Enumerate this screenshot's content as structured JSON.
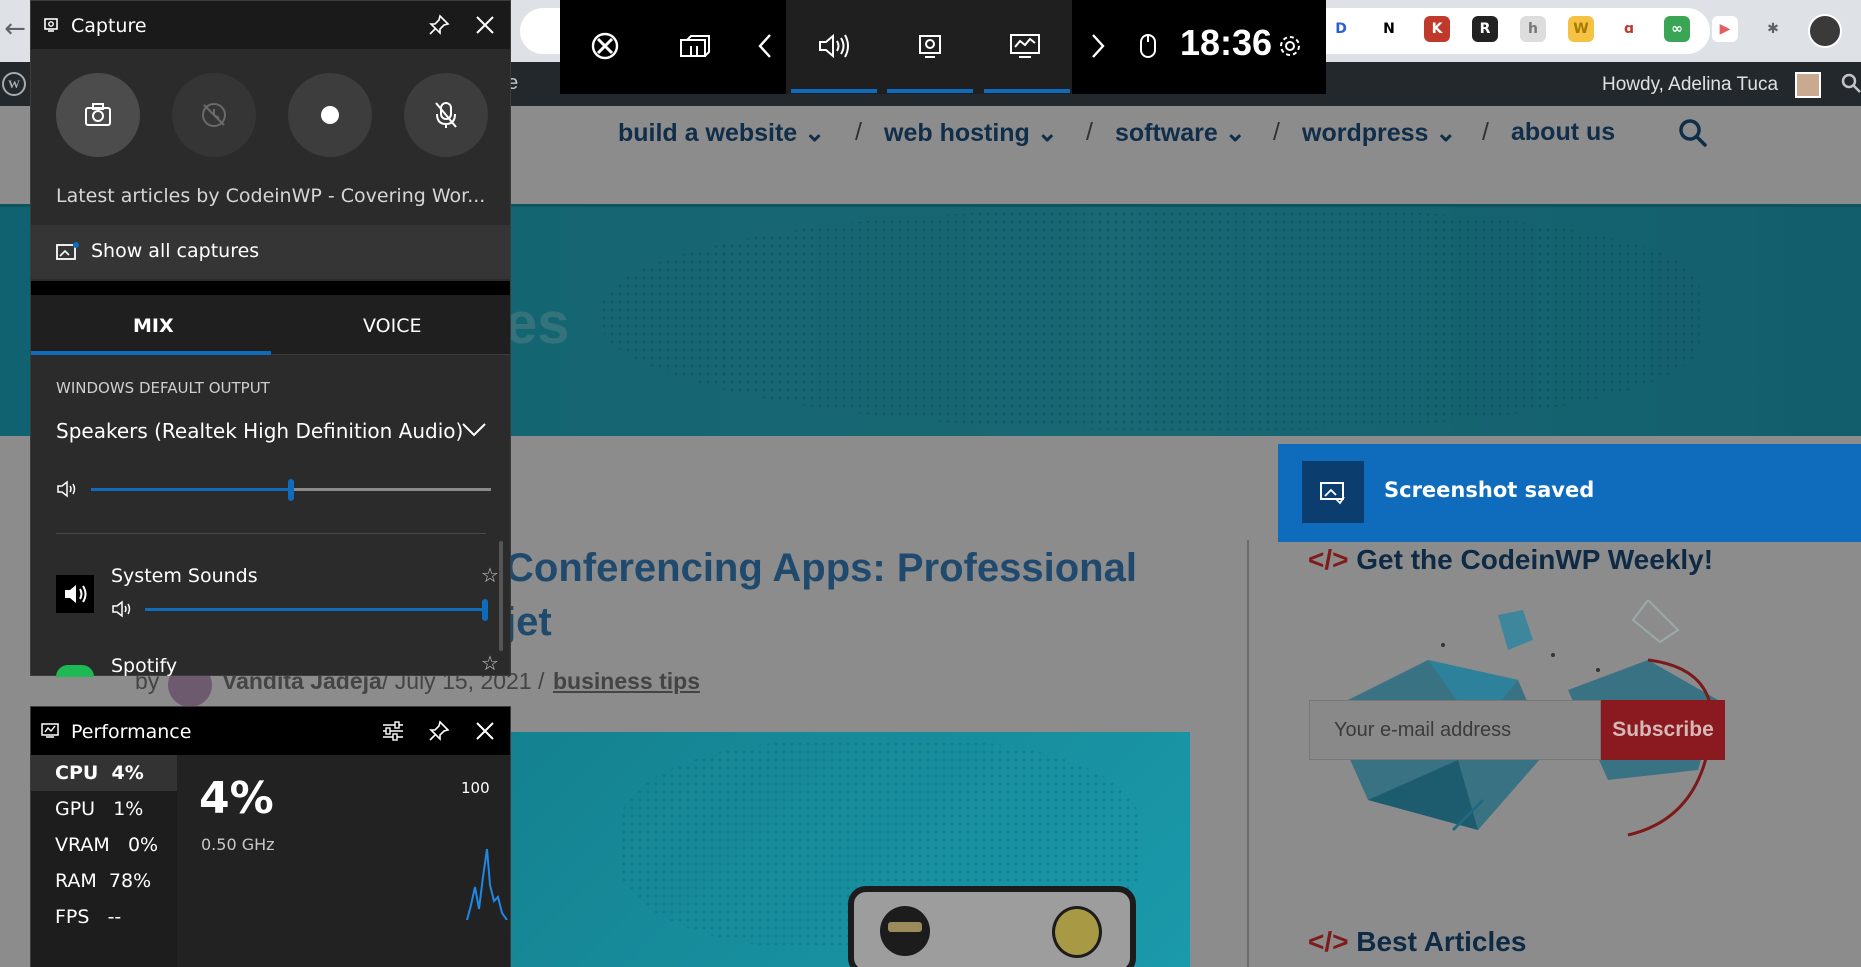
{
  "browser": {
    "back_glyph": "←",
    "wp_fragment": "ge",
    "howdy": "Howdy, Adelina Tuca",
    "extensions": [
      {
        "letter": "D",
        "color": "#2b5fd9",
        "bg": "#ffffff"
      },
      {
        "letter": "N",
        "color": "#000000",
        "bg": "#ffffff"
      },
      {
        "letter": "K",
        "color": "#ffffff",
        "bg": "#c0392b"
      },
      {
        "letter": "R",
        "color": "#ffffff",
        "bg": "#222222"
      },
      {
        "letter": "h",
        "color": "#777777",
        "bg": "#dddddd"
      },
      {
        "letter": "W",
        "color": "#a57b00",
        "bg": "#f6c244"
      },
      {
        "letter": "ɑ",
        "color": "#c0392b",
        "bg": "#ffffff"
      },
      {
        "letter": "∞",
        "color": "#ffffff",
        "bg": "#3aa655"
      },
      {
        "letter": "▶",
        "color": "#e06060",
        "bg": "#ffffff"
      },
      {
        "letter": "✱",
        "color": "#5f6368",
        "bg": "#dee1e6"
      }
    ]
  },
  "site": {
    "nav": [
      {
        "label": "build a website"
      },
      {
        "label": "web hosting"
      },
      {
        "label": "software"
      },
      {
        "label": "wordpress"
      },
      {
        "label": "about us"
      }
    ],
    "nav_separator": "/",
    "hero_fragment": "es",
    "article_title_line1": "Conferencing Apps: Professional",
    "article_title_line2": "jet",
    "byline_prefix": "by",
    "author": "Vandita Jadeja",
    "date": "/ July 15, 2021 /",
    "category": "business tips",
    "sidebar": {
      "code_tag": "</>",
      "weekly_title": "Get the CodeinWP Weekly!",
      "email_placeholder": "Your e-mail address",
      "subscribe_label": "Subscribe",
      "best_title": "Best Articles"
    }
  },
  "xbox_bar": {
    "clock": "18:36",
    "icons": [
      "xbox-icon",
      "widget-menu-icon",
      "chevron-left-icon",
      "audio-icon",
      "capture-icon",
      "performance-icon",
      "chevron-right-icon",
      "mouse-icon",
      "settings-icon"
    ],
    "accent": "#0f6cbd"
  },
  "capture": {
    "title": "Capture",
    "description": "Latest articles by CodeinWP - Covering Wor...",
    "show_all": "Show all captures"
  },
  "audio": {
    "tabs": [
      {
        "label": "MIX"
      },
      {
        "label": "VOICE"
      }
    ],
    "output_label": "WINDOWS DEFAULT OUTPUT",
    "output_device": "Speakers (Realtek High Definition Audio)",
    "master_volume": 0.5,
    "apps": [
      {
        "name": "System Sounds",
        "volume": 1.0
      },
      {
        "name": "Spotify"
      }
    ]
  },
  "performance": {
    "title": "Performance",
    "rows": [
      {
        "label": "CPU",
        "value": "4%"
      },
      {
        "label": "GPU",
        "value": "1%"
      },
      {
        "label": "VRAM",
        "value": "0%"
      },
      {
        "label": "RAM",
        "value": "78%"
      },
      {
        "label": "FPS",
        "value": "--"
      }
    ],
    "big_value": "4%",
    "frequency": "0.50 GHz",
    "scale_max": "100"
  },
  "toast": {
    "label": "Screenshot saved"
  }
}
